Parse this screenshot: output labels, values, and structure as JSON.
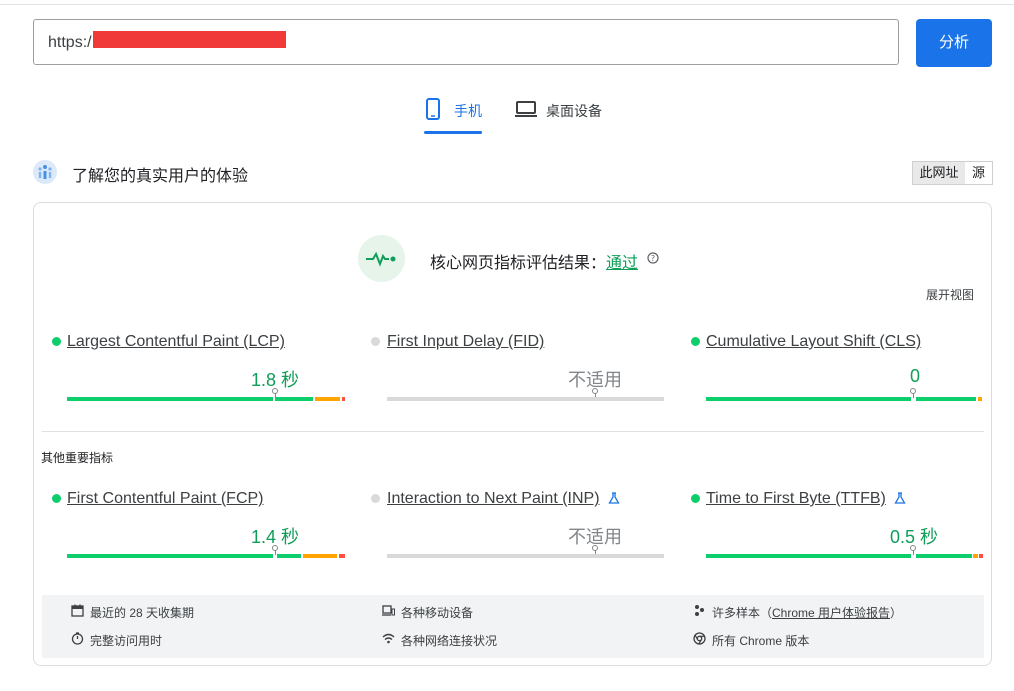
{
  "search": {
    "url_prefix": "https:/",
    "analyze_label": "分析"
  },
  "tabs": [
    {
      "label": "手机",
      "icon": "phone-icon",
      "active": true
    },
    {
      "label": "桌面设备",
      "icon": "laptop-icon",
      "active": false
    }
  ],
  "section": {
    "title": "了解您的真实用户的体验",
    "toggle_url": "此网址",
    "toggle_origin": "源"
  },
  "cwv": {
    "label": "核心网页指标评估结果：",
    "result": "通过",
    "expand_label": "展开视图"
  },
  "metrics": [
    {
      "title": "Largest Contentful Paint (LCP)",
      "value": "1.8 秒",
      "status": "good",
      "dist": [
        0.74,
        0.14,
        0.12
      ]
    },
    {
      "title": "First Input Delay (FID)",
      "value": "不适用",
      "status": "na"
    },
    {
      "title": "Cumulative Layout Shift (CLS)",
      "value": "0",
      "status": "good",
      "dist": [
        0.98,
        0.01,
        0.01
      ]
    }
  ],
  "other_label": "其他重要指标",
  "other_metrics": [
    {
      "title": "First Contentful Paint (FCP)",
      "value": "1.4 秒",
      "status": "good",
      "experimental": false
    },
    {
      "title": "Interaction to Next Paint (INP)",
      "value": "不适用",
      "status": "na",
      "experimental": true
    },
    {
      "title": "Time to First Byte (TTFB)",
      "value": "0.5 秒",
      "status": "good",
      "experimental": true
    }
  ],
  "footer": {
    "period": "最近的 28 天收集期",
    "devices": "各种移动设备",
    "samples_prefix": "许多样本（",
    "samples_link": "Chrome 用户体验报告",
    "samples_suffix": "）",
    "visit": "完整访问用时",
    "network": "各种网络连接状况",
    "chrome": "所有 Chrome 版本"
  },
  "colors": {
    "accent": "#1a73e8",
    "good": "#0cce6b",
    "needs_improvement": "#ffa400",
    "poor": "#ff4e42",
    "na": "#d9d9d9"
  }
}
